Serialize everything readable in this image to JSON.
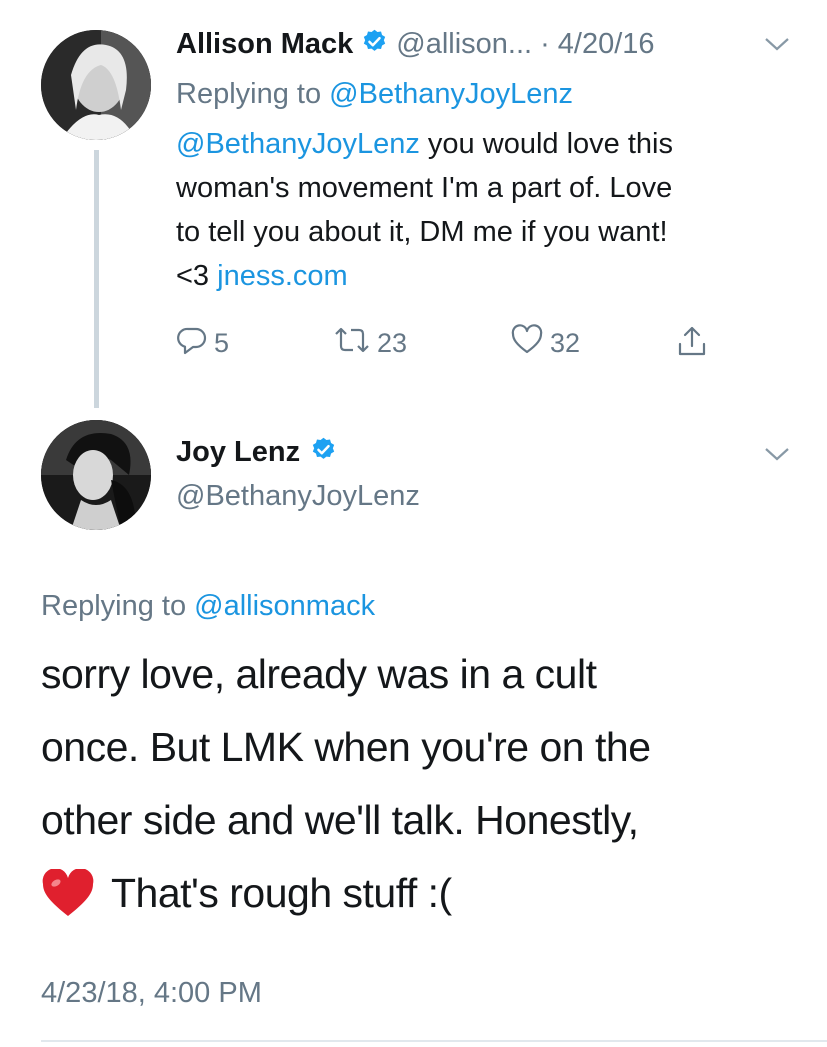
{
  "parent_tweet": {
    "name": "Allison Mack",
    "handle": "@allison...",
    "date_sep": "·",
    "date": "4/20/16",
    "replying_prefix": "Replying to",
    "replying_to": "@BethanyJoyLenz",
    "text_mention": "@BethanyJoyLenz",
    "text_1": " you would love this",
    "text_2": "woman's movement I'm a part of. Love",
    "text_3": "to tell you about it, DM me if you want!",
    "text_4_prefix": "<3 ",
    "text_4_link": "jness.com",
    "replies": "5",
    "retweets": "23",
    "likes": "32"
  },
  "main_tweet": {
    "name": "Joy Lenz",
    "handle": "@BethanyJoyLenz",
    "replying_prefix": "Replying to",
    "replying_to": "@allisonmack",
    "line_1": "sorry love, already was in a cult",
    "line_2": "once.  But LMK when you're on the",
    "line_3": "other side and we'll talk.  Honestly,",
    "line_4": "That's rough stuff :(",
    "timestamp": "4/23/18, 4:00 PM"
  },
  "colors": {
    "link": "#1b95e0",
    "secondary": "#657786",
    "heart_emoji": "#e0202e"
  }
}
